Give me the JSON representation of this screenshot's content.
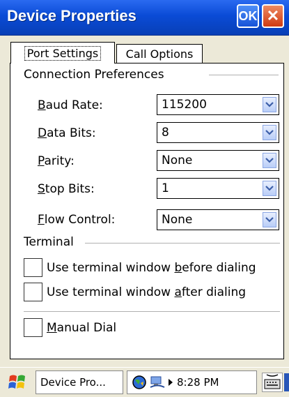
{
  "window": {
    "title": "Device Properties",
    "ok_label": "OK",
    "close_label": "✕"
  },
  "tabs": [
    {
      "label": "Port Settings",
      "selected": true
    },
    {
      "label": "Call Options",
      "selected": false
    }
  ],
  "sections": {
    "connection": "Connection Preferences",
    "terminal": "Terminal"
  },
  "fields": {
    "baud_rate": {
      "label_pre": "",
      "label_key": "B",
      "label_post": "aud Rate:",
      "value": "115200"
    },
    "data_bits": {
      "label_pre": "",
      "label_key": "D",
      "label_post": "ata Bits:",
      "value": "8"
    },
    "parity": {
      "label_pre": "",
      "label_key": "P",
      "label_post": "arity:",
      "value": "None"
    },
    "stop_bits": {
      "label_pre": "",
      "label_key": "S",
      "label_post": "top Bits:",
      "value": "1"
    },
    "flow_control": {
      "label_pre": "",
      "label_key": "F",
      "label_post": "low Control:",
      "value": "None"
    }
  },
  "checkboxes": {
    "before": {
      "pre": "Use terminal window ",
      "key": "b",
      "post": "efore dialing",
      "checked": false
    },
    "after": {
      "pre": "Use terminal window ",
      "key": "a",
      "post": "fter dialing",
      "checked": false
    },
    "manual": {
      "pre": "",
      "key": "M",
      "post": "anual Dial",
      "checked": false
    }
  },
  "taskbar": {
    "task_label": "Device Pro...",
    "time": "8:28 PM"
  },
  "colors": {
    "titlebar": "#0a4bd6",
    "dialog_bg": "#ffffff",
    "chrome_bg": "#ece9d8"
  }
}
